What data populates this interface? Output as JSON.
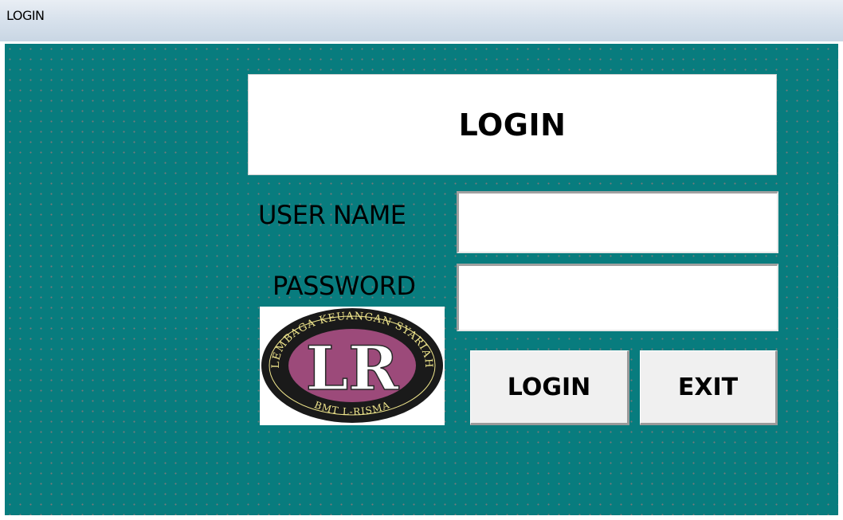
{
  "window": {
    "title": "LOGIN"
  },
  "form": {
    "heading": "LOGIN",
    "username_label": "USER NAME",
    "username_value": "",
    "password_label": "PASSWORD",
    "password_value": "",
    "login_button": "LOGIN",
    "exit_button": "EXIT"
  },
  "logo": {
    "ring_text_top": "LEMBAGA KEUANGAN SYARIAH",
    "ring_text_bottom": "BMT L-RISMA",
    "monogram": "LR",
    "ring_color": "#1a1a1a",
    "center_color": "#9c4a7a"
  },
  "colors": {
    "background": "#087c7e",
    "panel": "#ffffff",
    "button": "#f0f0f0"
  }
}
